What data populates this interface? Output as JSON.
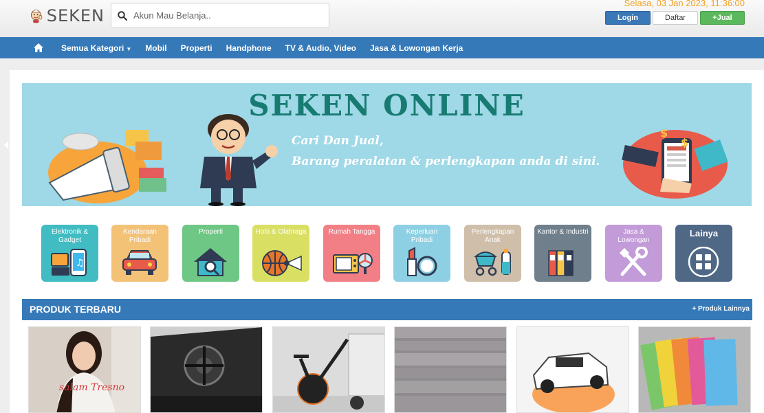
{
  "header": {
    "logo_text": "SEKEN",
    "search_placeholder": "Akun Mau Belanja..",
    "datetime": "Selasa, 03 Jan 2023, 11:36:00",
    "login_label": "Login",
    "daftar_label": "Daftar",
    "jual_label": "+Jual"
  },
  "nav": {
    "items": [
      {
        "label": "Semua Kategori"
      },
      {
        "label": "Mobil"
      },
      {
        "label": "Properti"
      },
      {
        "label": "Handphone"
      },
      {
        "label": "TV & Audio, Video"
      },
      {
        "label": "Jasa & Lowongan Kerja"
      }
    ],
    "dropdown_icon": "▼"
  },
  "banner": {
    "title": "SEKEN ONLINE",
    "tagline_1": "Cari Dan Jual,",
    "tagline_2": "Barang peralatan & perlengkapan anda di sini."
  },
  "categories": [
    {
      "label": "Elektronik & Gadget",
      "color": "#40bcc2",
      "icon": "gadget-icon"
    },
    {
      "label": "Kendaraan Pribadi",
      "color": "#f3c277",
      "icon": "car-icon"
    },
    {
      "label": "Properti",
      "color": "#6ec785",
      "icon": "house-search-icon"
    },
    {
      "label": "Hobi & Olahraga",
      "color": "#d9df63",
      "icon": "ball-icon"
    },
    {
      "label": "Rumah Tangga",
      "color": "#f27f86",
      "icon": "appliance-icon"
    },
    {
      "label": "Keperluan Pribadi",
      "color": "#8ed0e3",
      "icon": "cosmetic-icon"
    },
    {
      "label": "Perlengkapan Anak",
      "color": "#cfbfaa",
      "icon": "stroller-icon"
    },
    {
      "label": "Kantor & Industri",
      "color": "#6f7f8c",
      "icon": "binder-icon"
    },
    {
      "label": "Jasa & Lowongan",
      "color": "#c29bd8",
      "icon": "tools-icon"
    },
    {
      "label": "Lainya",
      "color": "#4f6886",
      "icon": "grid-icon"
    }
  ],
  "section": {
    "title": "PRODUK TERBARU",
    "more_label": "+ Produk Lainnya"
  },
  "products": [
    {
      "caption": "salam Tresno"
    },
    {
      "caption": ""
    },
    {
      "caption": ""
    },
    {
      "caption": ""
    },
    {
      "caption": ""
    },
    {
      "caption": ""
    }
  ],
  "colors": {
    "brand_blue": "#3679b8",
    "banner_bg": "#9fd8e6",
    "banner_title": "#177b72",
    "datetime": "#f0a020",
    "jual_green": "#5cb85c"
  }
}
